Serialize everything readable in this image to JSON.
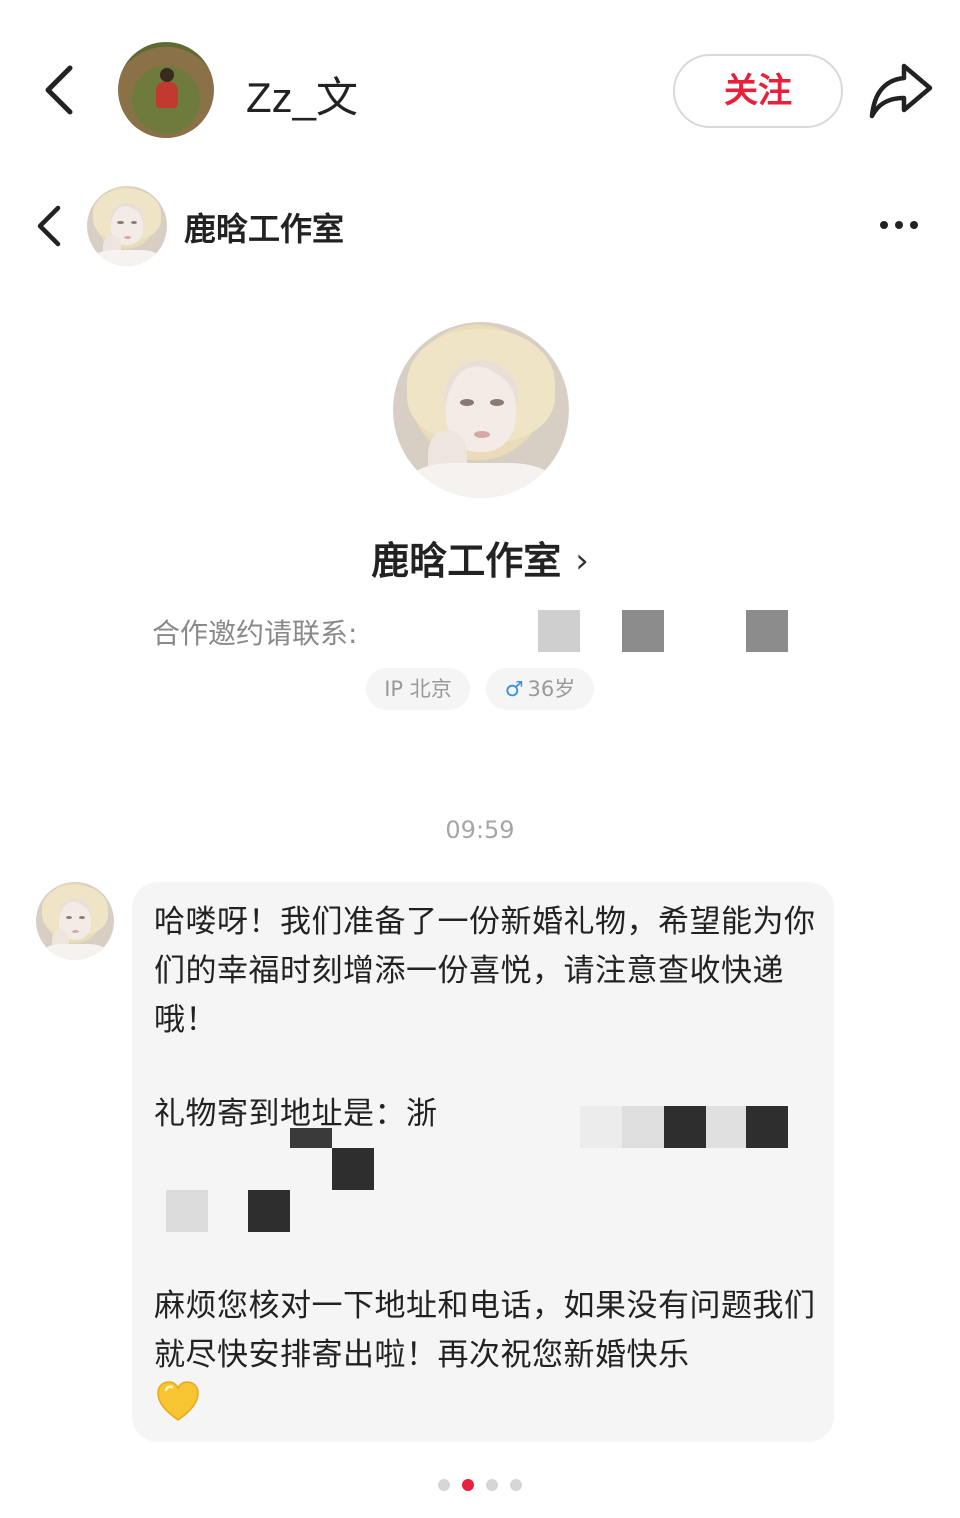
{
  "header": {
    "user_name": "Zz_文",
    "follow_label": "关注"
  },
  "chat_header": {
    "title": "鹿晗工作室"
  },
  "profile": {
    "name": "鹿晗工作室",
    "contact_label": "合作邀约请联系:",
    "tags": {
      "ip": "IP 北京",
      "age_symbol": "♂",
      "age": "36岁"
    }
  },
  "chat": {
    "timestamp": "09:59",
    "message": {
      "paragraph1": "哈喽呀！我们准备了一份新婚礼物，希望能为你们的幸福时刻增添一份喜悦，请注意查收快递哦！",
      "address_label": "礼物寄到地址是：",
      "address_partial": "浙",
      "paragraph3": "麻烦您核对一下地址和电话，如果没有问题我们就尽快安排寄出啦！再次祝您新婚快乐",
      "emoji": "yellow-heart"
    }
  },
  "pagination": {
    "total": 4,
    "active_index": 1
  },
  "colors": {
    "accent": "#e8213b",
    "bubble_bg": "#f5f5f5",
    "muted_text": "#8a8a8a",
    "gender_blue": "#3d8fe0",
    "heart_yellow": "#f7c531"
  }
}
